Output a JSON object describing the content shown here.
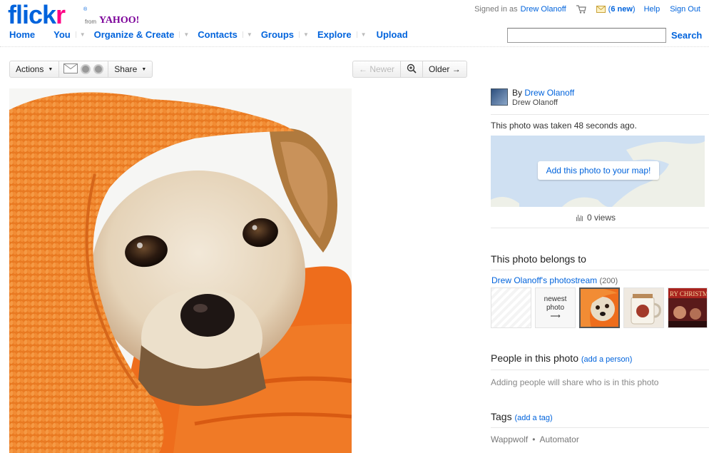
{
  "header": {
    "logo_flickr": "flick",
    "logo_r": "r",
    "logo_from": "from",
    "logo_yahoo": "YAHOO!",
    "signed_in_as": "Signed in as",
    "user_name": "Drew Olanoff",
    "new_messages_open": "(",
    "new_messages_count": "6 new",
    "new_messages_close": ")",
    "help": "Help",
    "sign_out": "Sign Out",
    "search_button": "Search",
    "search_value": ""
  },
  "nav": [
    {
      "label": "Home",
      "has_menu": false
    },
    {
      "label": "You",
      "has_menu": true
    },
    {
      "label": "Organize & Create",
      "has_menu": true
    },
    {
      "label": "Contacts",
      "has_menu": true
    },
    {
      "label": "Groups",
      "has_menu": true
    },
    {
      "label": "Explore",
      "has_menu": true
    },
    {
      "label": "Upload",
      "has_menu": false
    }
  ],
  "toolbar": {
    "actions": "Actions",
    "share": "Share",
    "newer": "← Newer",
    "older": "Older →"
  },
  "photo": {
    "subject": "small tan dog wrapped in orange knit blanket"
  },
  "sidebar": {
    "by_prefix": "By",
    "owner_name": "Drew Olanoff",
    "owner_sub": "Drew Olanoff",
    "taken": "This photo was taken 48 seconds ago.",
    "map_button": "Add this photo to your map!",
    "views": "0 views",
    "belongs_title": "This photo belongs to",
    "stream_name": "Drew Olanoff's photostream",
    "stream_count": "(200)",
    "newest_line1": "newest",
    "newest_line2": "photo",
    "newest_arrow": "⟶",
    "people_title": "People in this photo",
    "add_person_open": "(",
    "add_person": "add a person",
    "add_person_close": ")",
    "adding_people_text": "Adding people will share who is in this photo",
    "tags_title": "Tags",
    "add_tag_open": "(",
    "add_tag": "add a tag",
    "add_tag_close": ")",
    "tags": [
      "Wappwolf",
      "Automator"
    ],
    "tag_separator": "•"
  },
  "colors": {
    "link_blue": "#0063dc",
    "flickr_pink": "#ff0084",
    "yahoo_purple": "#7b0099",
    "blanket_orange": "#e8741f"
  }
}
